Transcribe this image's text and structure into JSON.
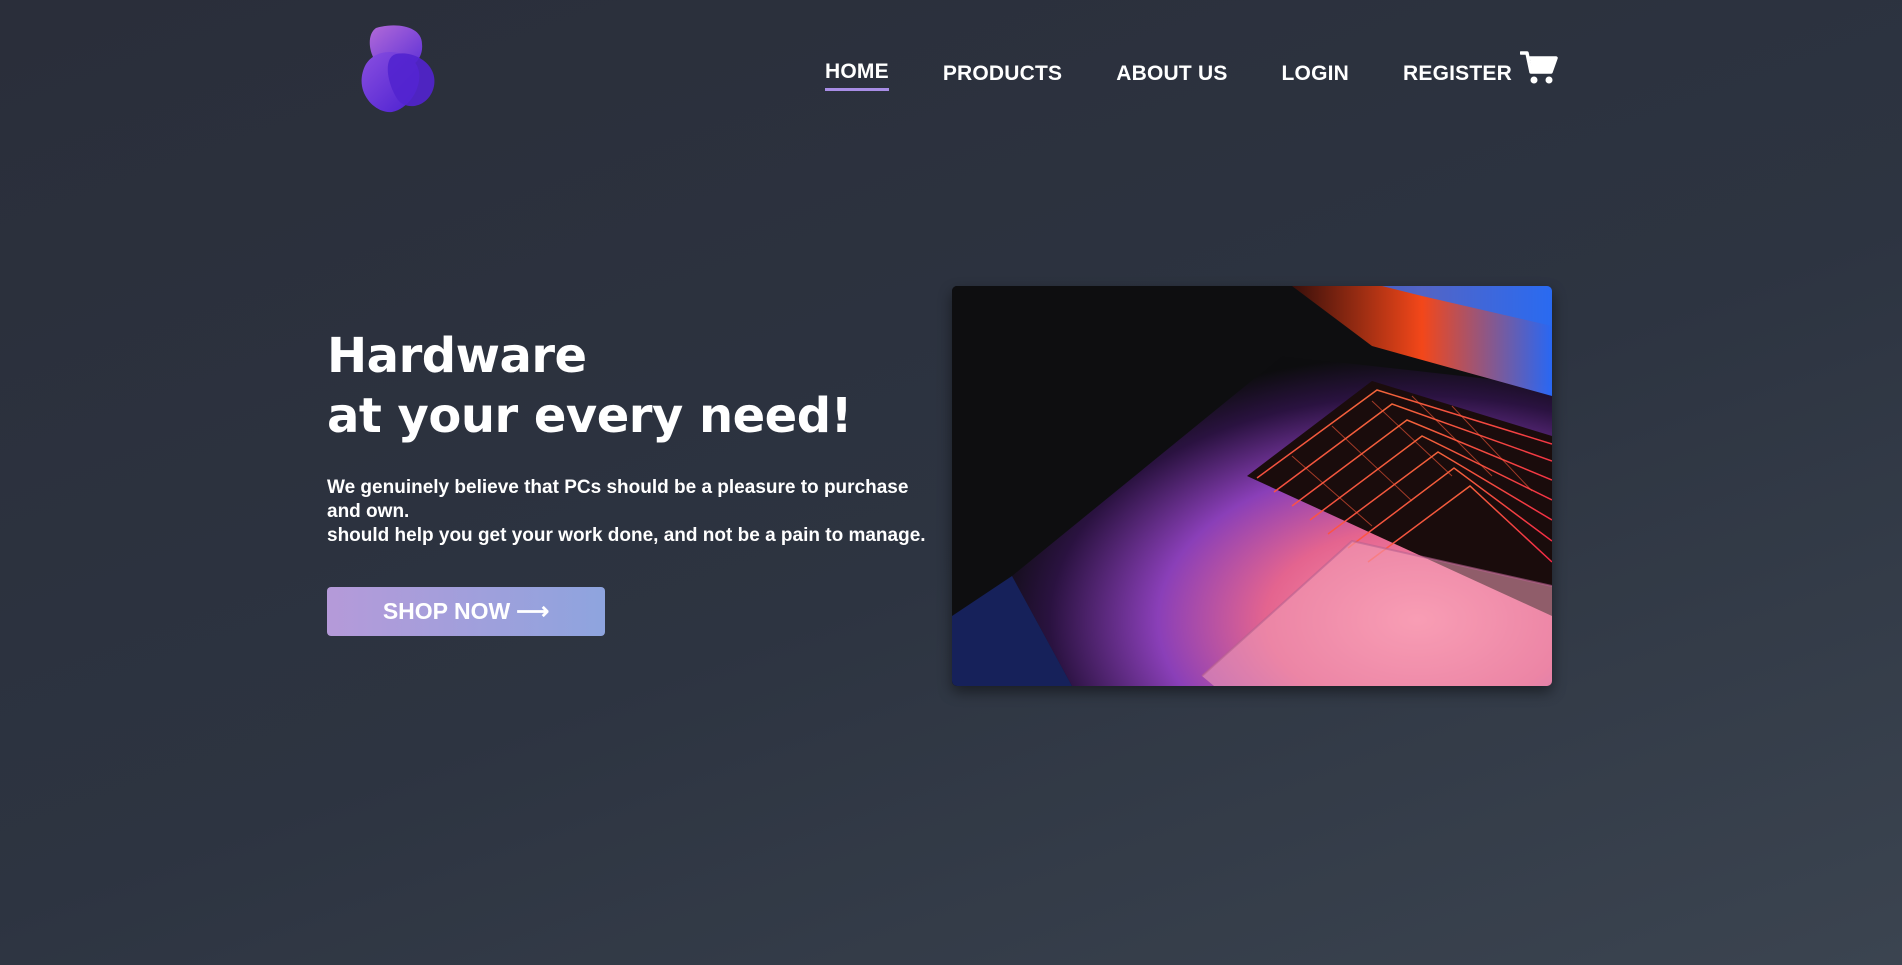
{
  "header": {
    "logo_icon": "blob-logo-icon",
    "nav": [
      {
        "label": "HOME",
        "active": true
      },
      {
        "label": "PRODUCTS",
        "active": false
      },
      {
        "label": "ABOUT US",
        "active": false
      },
      {
        "label": "LOGIN",
        "active": false
      },
      {
        "label": "REGISTER",
        "active": false
      }
    ],
    "cart_icon": "shopping-cart-icon"
  },
  "hero": {
    "title_line1": "Hardware",
    "title_line2": "at your every need!",
    "description_line1": "We genuinely believe that PCs should be a pleasure to purchase and own.",
    "description_line2": "should help you get your work done, and not be a pain to manage.",
    "cta_label": "SHOP NOW",
    "cta_arrow": "⟶",
    "image_subject": "laptop-keyboard-image"
  },
  "colors": {
    "background_start": "#2a2e3a",
    "background_end": "#3b4450",
    "accent": "#a88de6",
    "button_start": "#b59ad9",
    "button_end": "#8ea4de",
    "logo_purple": "#6a3fd8"
  }
}
